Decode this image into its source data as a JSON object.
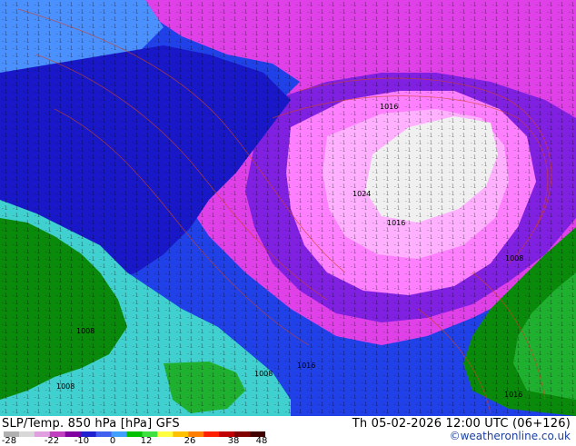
{
  "title": "SLP/Temp. 850 hPa [hPa] GFS",
  "datetime": "Th 05-02-2026 12:00 UTC (06+126)",
  "copyright": "©weatheronline.co.uk",
  "legend": {
    "ticks": [
      "-28",
      "-22",
      "-10",
      "0",
      "12",
      "26",
      "38",
      "48"
    ],
    "colors": [
      "#b0b0b0",
      "#d8d8d8",
      "#e0a0e0",
      "#c040c0",
      "#8000a0",
      "#2020d0",
      "#4060f0",
      "#40a0ff",
      "#00c000",
      "#40e040",
      "#ffff40",
      "#ffc000",
      "#ff8000",
      "#ff2000",
      "#c00000",
      "#800000",
      "#400000"
    ]
  },
  "map": {
    "pressure_labels": [
      "1008",
      "1016",
      "1024",
      "1016",
      "1008",
      "1016",
      "1008",
      "1016",
      "1008"
    ],
    "region_colors": {
      "green": "#0a8a0a",
      "light_green": "#20b030",
      "cyan": "#40d0d0",
      "light_blue": "#4a90ff",
      "blue": "#2040e8",
      "dark_blue": "#1818c8",
      "violet": "#8020e0",
      "magenta": "#e040e8",
      "light_magenta": "#ff80ff",
      "pink": "#ffb0ff",
      "core": "#f0f0f0"
    }
  }
}
